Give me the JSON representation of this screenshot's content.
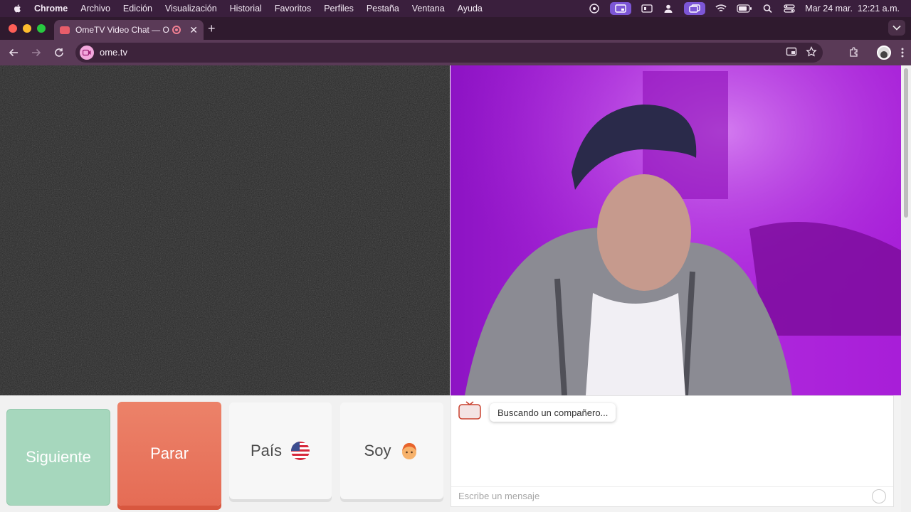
{
  "menubar": {
    "app_name": "Chrome",
    "items": [
      "Archivo",
      "Edición",
      "Visualización",
      "Historial",
      "Favoritos",
      "Perfiles",
      "Pestaña",
      "Ventana",
      "Ayuda"
    ],
    "datetime": "Mar 24 mar.  12:21 a.m."
  },
  "browser": {
    "tab_title": "OmeTV Video Chat — Omegle",
    "url": "ome.tv"
  },
  "controls": {
    "next_label": "Siguiente",
    "stop_label": "Parar",
    "country_label": "País",
    "gender_label": "Soy"
  },
  "chat": {
    "logo_text": "Ome TV",
    "status_message": "Buscando un compañero...",
    "input_placeholder": "Escribe un mensaje"
  },
  "colors": {
    "menubar": "#3a1f3d",
    "toolbar": "#5a3a57",
    "next_button": "#a6d7bd",
    "stop_button": "#e56c55",
    "self_video_tint": "#9a19c8"
  },
  "icons": {
    "country_flag": "us-flag-icon",
    "gender_avatar": "boy-avatar-icon"
  }
}
